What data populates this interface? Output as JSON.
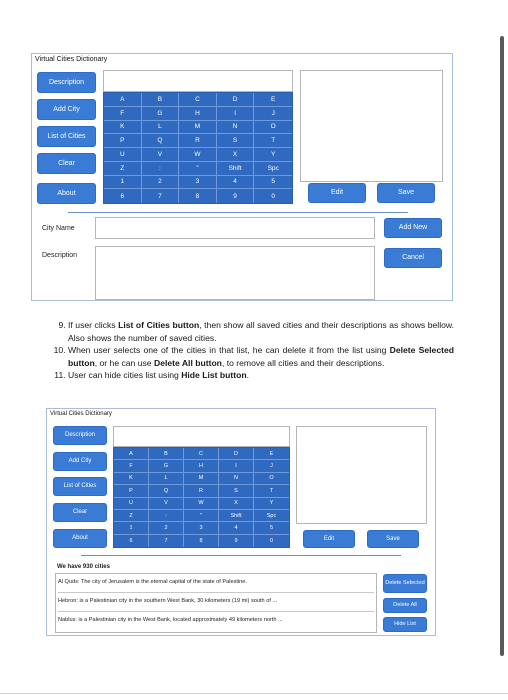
{
  "window_title": "Virtual Cities Dictionary",
  "side_buttons": [
    "Description",
    "Add City",
    "List of Cities",
    "Clear",
    "About"
  ],
  "keyboard_rows": [
    [
      "A",
      "B",
      "C",
      "D",
      "E"
    ],
    [
      "F",
      "G",
      "H",
      "I",
      "J"
    ],
    [
      "K",
      "L",
      "M",
      "N",
      "O"
    ],
    [
      "P",
      "Q",
      "R",
      "S",
      "T"
    ],
    [
      "U",
      "V",
      "W",
      "X",
      "Y"
    ],
    [
      "Z",
      ":",
      "\"",
      "Shift",
      "Spc"
    ],
    [
      "1",
      "2",
      "3",
      "4",
      "5"
    ],
    [
      "6",
      "7",
      "8",
      "9",
      "0"
    ]
  ],
  "edit_label": "Edit",
  "save_label": "Save",
  "city_name_label": "City Name",
  "description_label": "Description",
  "add_new_label": "Add New",
  "cancel_label": "Cancel",
  "instructions": [
    {
      "num": 9,
      "text": "If user clicks List of Cities button, then show all saved cities and their descriptions as shows bellow. Also shows the number of saved cities."
    },
    {
      "num": 10,
      "text": "When user selects one of the cities in that list, he can delete it from the list using Delete Selected button, or he can use Delete All button, to remove all cities and their descriptions."
    },
    {
      "num": 11,
      "text": "User can hide cities list using Hide List button."
    }
  ],
  "cities_count_text": "We have 930 cities",
  "city_list": [
    "Al Quds: The city of Jerusalem is the eternal capital of the state of Palestine.",
    "Hebron: is a Palestinian city in the southern West Bank, 30 kilometers (19 mi) south of ...",
    "Nablus: is a Palestinian city in the West Bank, located approximately 49 kilometers north ..."
  ],
  "delete_selected_label": "Delete Selected",
  "delete_all_label": "Delete All",
  "hide_list_label": "Hide List"
}
